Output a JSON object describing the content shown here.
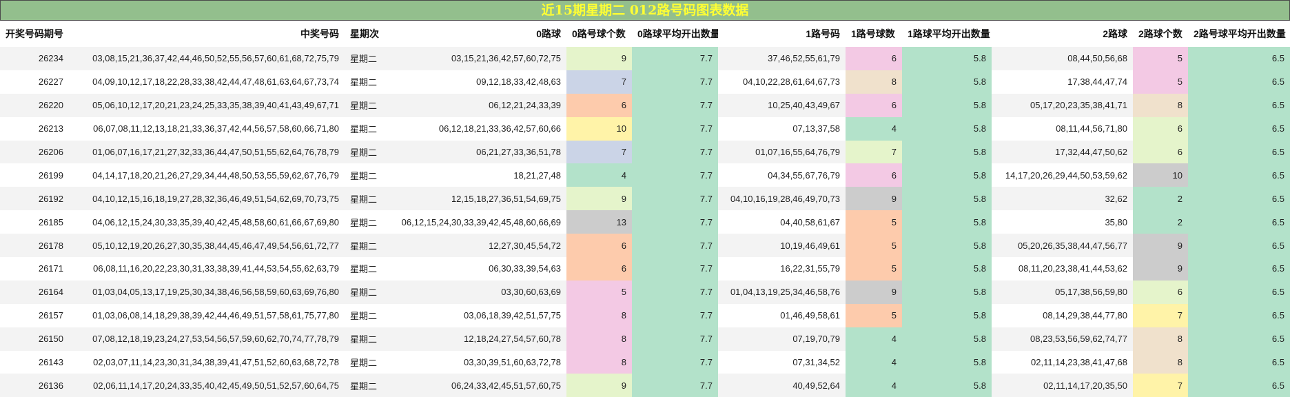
{
  "title": "近15期星期二 012路号码图表数据",
  "headers": [
    "开奖号码期号",
    "中奖号码",
    "星期次",
    "0路球",
    "0路号球个数",
    "0路球平均开出数量",
    "1路号码",
    "1路号球数",
    "1路球平均开出数量",
    "2路球",
    "2路球个数",
    "2路号球平均开出数量"
  ],
  "rows": [
    {
      "period": "26234",
      "numbers": "03,08,15,21,36,37,42,44,46,50,52,55,56,57,60,61,68,72,75,79",
      "weekday": "星期二",
      "r0": "03,15,21,36,42,57,60,72,75",
      "c0": "9",
      "a0": "7.7",
      "r1": "37,46,52,55,61,79",
      "c1": "6",
      "a1": "5.8",
      "r2": "08,44,50,56,68",
      "c2": "5",
      "a2": "6.5"
    },
    {
      "period": "26227",
      "numbers": "04,09,10,12,17,18,22,28,33,38,42,44,47,48,61,63,64,67,73,74",
      "weekday": "星期二",
      "r0": "09,12,18,33,42,48,63",
      "c0": "7",
      "a0": "7.7",
      "r1": "04,10,22,28,61,64,67,73",
      "c1": "8",
      "a1": "5.8",
      "r2": "17,38,44,47,74",
      "c2": "5",
      "a2": "6.5"
    },
    {
      "period": "26220",
      "numbers": "05,06,10,12,17,20,21,23,24,25,33,35,38,39,40,41,43,49,67,71",
      "weekday": "星期二",
      "r0": "06,12,21,24,33,39",
      "c0": "6",
      "a0": "7.7",
      "r1": "10,25,40,43,49,67",
      "c1": "6",
      "a1": "5.8",
      "r2": "05,17,20,23,35,38,41,71",
      "c2": "8",
      "a2": "6.5"
    },
    {
      "period": "26213",
      "numbers": "06,07,08,11,12,13,18,21,33,36,37,42,44,56,57,58,60,66,71,80",
      "weekday": "星期二",
      "r0": "06,12,18,21,33,36,42,57,60,66",
      "c0": "10",
      "a0": "7.7",
      "r1": "07,13,37,58",
      "c1": "4",
      "a1": "5.8",
      "r2": "08,11,44,56,71,80",
      "c2": "6",
      "a2": "6.5"
    },
    {
      "period": "26206",
      "numbers": "01,06,07,16,17,21,27,32,33,36,44,47,50,51,55,62,64,76,78,79",
      "weekday": "星期二",
      "r0": "06,21,27,33,36,51,78",
      "c0": "7",
      "a0": "7.7",
      "r1": "01,07,16,55,64,76,79",
      "c1": "7",
      "a1": "5.8",
      "r2": "17,32,44,47,50,62",
      "c2": "6",
      "a2": "6.5"
    },
    {
      "period": "26199",
      "numbers": "04,14,17,18,20,21,26,27,29,34,44,48,50,53,55,59,62,67,76,79",
      "weekday": "星期二",
      "r0": "18,21,27,48",
      "c0": "4",
      "a0": "7.7",
      "r1": "04,34,55,67,76,79",
      "c1": "6",
      "a1": "5.8",
      "r2": "14,17,20,26,29,44,50,53,59,62",
      "c2": "10",
      "a2": "6.5"
    },
    {
      "period": "26192",
      "numbers": "04,10,12,15,16,18,19,27,28,32,36,46,49,51,54,62,69,70,73,75",
      "weekday": "星期二",
      "r0": "12,15,18,27,36,51,54,69,75",
      "c0": "9",
      "a0": "7.7",
      "r1": "04,10,16,19,28,46,49,70,73",
      "c1": "9",
      "a1": "5.8",
      "r2": "32,62",
      "c2": "2",
      "a2": "6.5"
    },
    {
      "period": "26185",
      "numbers": "04,06,12,15,24,30,33,35,39,40,42,45,48,58,60,61,66,67,69,80",
      "weekday": "星期二",
      "r0": "06,12,15,24,30,33,39,42,45,48,60,66,69",
      "c0": "13",
      "a0": "7.7",
      "r1": "04,40,58,61,67",
      "c1": "5",
      "a1": "5.8",
      "r2": "35,80",
      "c2": "2",
      "a2": "6.5"
    },
    {
      "period": "26178",
      "numbers": "05,10,12,19,20,26,27,30,35,38,44,45,46,47,49,54,56,61,72,77",
      "weekday": "星期二",
      "r0": "12,27,30,45,54,72",
      "c0": "6",
      "a0": "7.7",
      "r1": "10,19,46,49,61",
      "c1": "5",
      "a1": "5.8",
      "r2": "05,20,26,35,38,44,47,56,77",
      "c2": "9",
      "a2": "6.5"
    },
    {
      "period": "26171",
      "numbers": "06,08,11,16,20,22,23,30,31,33,38,39,41,44,53,54,55,62,63,79",
      "weekday": "星期二",
      "r0": "06,30,33,39,54,63",
      "c0": "6",
      "a0": "7.7",
      "r1": "16,22,31,55,79",
      "c1": "5",
      "a1": "5.8",
      "r2": "08,11,20,23,38,41,44,53,62",
      "c2": "9",
      "a2": "6.5"
    },
    {
      "period": "26164",
      "numbers": "01,03,04,05,13,17,19,25,30,34,38,46,56,58,59,60,63,69,76,80",
      "weekday": "星期二",
      "r0": "03,30,60,63,69",
      "c0": "5",
      "a0": "7.7",
      "r1": "01,04,13,19,25,34,46,58,76",
      "c1": "9",
      "a1": "5.8",
      "r2": "05,17,38,56,59,80",
      "c2": "6",
      "a2": "6.5"
    },
    {
      "period": "26157",
      "numbers": "01,03,06,08,14,18,29,38,39,42,44,46,49,51,57,58,61,75,77,80",
      "weekday": "星期二",
      "r0": "03,06,18,39,42,51,57,75",
      "c0": "8",
      "a0": "7.7",
      "r1": "01,46,49,58,61",
      "c1": "5",
      "a1": "5.8",
      "r2": "08,14,29,38,44,77,80",
      "c2": "7",
      "a2": "6.5"
    },
    {
      "period": "26150",
      "numbers": "07,08,12,18,19,23,24,27,53,54,56,57,59,60,62,70,74,77,78,79",
      "weekday": "星期二",
      "r0": "12,18,24,27,54,57,60,78",
      "c0": "8",
      "a0": "7.7",
      "r1": "07,19,70,79",
      "c1": "4",
      "a1": "5.8",
      "r2": "08,23,53,56,59,62,74,77",
      "c2": "8",
      "a2": "6.5"
    },
    {
      "period": "26143",
      "numbers": "02,03,07,11,14,23,30,31,34,38,39,41,47,51,52,60,63,68,72,78",
      "weekday": "星期二",
      "r0": "03,30,39,51,60,63,72,78",
      "c0": "8",
      "a0": "7.7",
      "r1": "07,31,34,52",
      "c1": "4",
      "a1": "5.8",
      "r2": "02,11,14,23,38,41,47,68",
      "c2": "8",
      "a2": "6.5"
    },
    {
      "period": "26136",
      "numbers": "02,06,11,14,17,20,24,33,35,40,42,45,49,50,51,52,57,60,64,75",
      "weekday": "星期二",
      "r0": "06,24,33,42,45,51,57,60,75",
      "c0": "9",
      "a0": "7.7",
      "r1": "40,49,52,64",
      "c1": "4",
      "a1": "5.8",
      "r2": "02,11,14,17,20,35,50",
      "c2": "7",
      "a2": "6.5"
    }
  ],
  "count_colors": {
    "2": "#b3e2ca",
    "4": "#b3e2ca",
    "5": "#f3c9e4",
    "6": "#fdcbac",
    "7": "#cbd4e7",
    "8": "#f3c9e4",
    "9": "#e5f4cb",
    "10": "#fff3a8",
    "13": "#cccccc"
  },
  "count_colors_overrides": {
    "c1": {
      "4": "#b3e2ca",
      "5": "#fdcbac",
      "6": "#f3c9e4",
      "7": "#e5f4cb",
      "8": "#f0e1cc",
      "9": "#cccccc"
    },
    "c2": {
      "2": "#b3e2ca",
      "5": "#f3c9e4",
      "6": "#e5f4cb",
      "7": "#fff3a8",
      "8": "#f0e1cc",
      "9": "#cccccc",
      "10": "#cccccc"
    }
  },
  "avg_color": "#b3e2ca"
}
